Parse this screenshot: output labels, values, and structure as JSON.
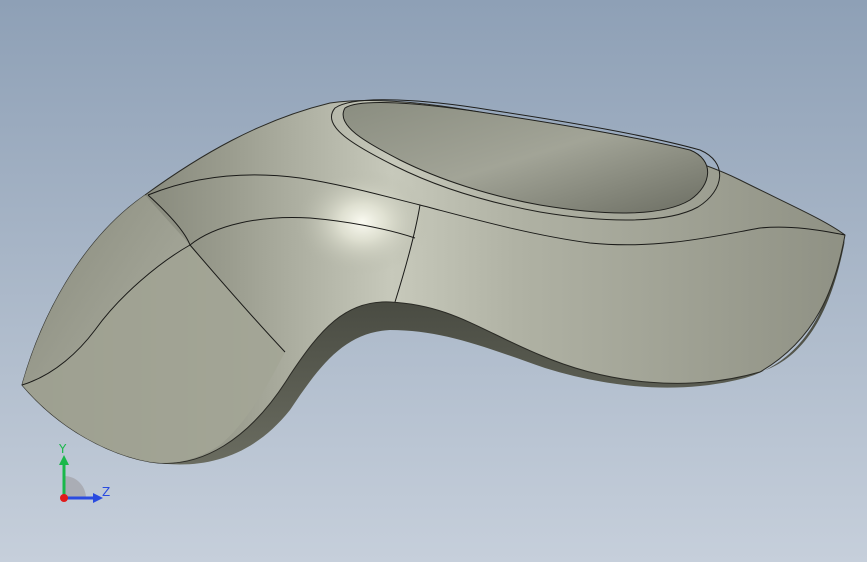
{
  "viewport": {
    "background_top": "#8ea0b6",
    "background_bottom": "#c6cfdb"
  },
  "model": {
    "body_color": "#a9ab9c",
    "highlight_color": "#f4f5e8",
    "shadow_color": "#4b4d44",
    "edge_color": "#1a1a1a"
  },
  "triad": {
    "y_label": "Y",
    "z_label": "Z",
    "y_color": "#19b84a",
    "z_color": "#2a4be0",
    "origin_color": "#e01b1b",
    "x_icon": "x-axis-dot-icon"
  }
}
